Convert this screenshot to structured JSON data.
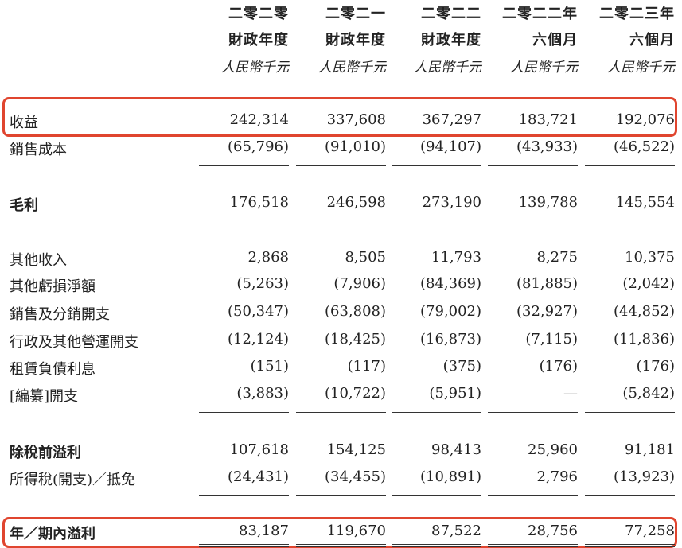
{
  "header": {
    "years": [
      "二零二零",
      "二零二一",
      "二零二二",
      "二零二二年",
      "二零二三年"
    ],
    "periods": [
      "財政年度",
      "財政年度",
      "財政年度",
      "六個月",
      "六個月"
    ],
    "units": [
      "人民幣千元",
      "人民幣千元",
      "人民幣千元",
      "人民幣千元",
      "人民幣千元"
    ]
  },
  "rows": [
    {
      "label": "收益",
      "values": [
        "242,314",
        "337,608",
        "367,297",
        "183,721",
        "192,076"
      ]
    },
    {
      "label": "銷售成本",
      "values": [
        "(65,796)",
        "(91,010)",
        "(94,107)",
        "(43,933)",
        "(46,522)"
      ]
    },
    {
      "label": "毛利",
      "values": [
        "176,518",
        "246,598",
        "273,190",
        "139,788",
        "145,554"
      ]
    },
    {
      "label": "其他收入",
      "values": [
        "2,868",
        "8,505",
        "11,793",
        "8,275",
        "10,375"
      ]
    },
    {
      "label": "其他虧損淨額",
      "values": [
        "(5,263)",
        "(7,906)",
        "(84,369)",
        "(81,885)",
        "(2,042)"
      ]
    },
    {
      "label": "銷售及分銷開支",
      "values": [
        "(50,347)",
        "(63,808)",
        "(79,002)",
        "(32,927)",
        "(44,852)"
      ]
    },
    {
      "label": "行政及其他營運開支",
      "values": [
        "(12,124)",
        "(18,425)",
        "(16,873)",
        "(7,115)",
        "(11,836)"
      ]
    },
    {
      "label": "租賃負債利息",
      "values": [
        "(151)",
        "(117)",
        "(375)",
        "(176)",
        "(176)"
      ]
    },
    {
      "label": "[編纂]開支",
      "values": [
        "(3,883)",
        "(10,722)",
        "(5,951)",
        "—",
        "(5,842)"
      ]
    },
    {
      "label": "除稅前溢利",
      "values": [
        "107,618",
        "154,125",
        "98,413",
        "25,960",
        "91,181"
      ]
    },
    {
      "label": "所得稅(開支)／抵免",
      "values": [
        "(24,431)",
        "(34,455)",
        "(10,891)",
        "2,796",
        "(13,923)"
      ]
    },
    {
      "label": "年／期內溢利",
      "values": [
        "83,187",
        "119,670",
        "87,522",
        "28,756",
        "77,258"
      ]
    }
  ],
  "colors": {
    "highlight": "#e0452f",
    "text": "#222222",
    "rule": "#333333"
  }
}
